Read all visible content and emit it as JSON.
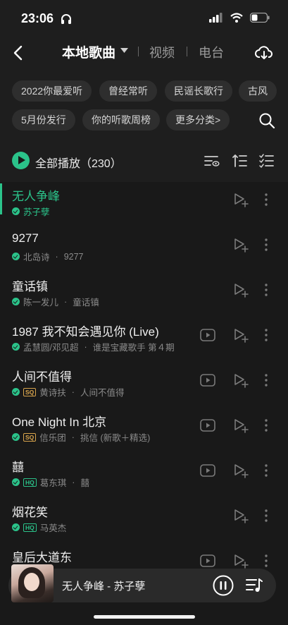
{
  "status_bar": {
    "time": "23:06"
  },
  "nav": {
    "title": "本地歌曲",
    "tabs": [
      "视频",
      "电台"
    ]
  },
  "chips": {
    "row1": [
      "2022你最爱听",
      "曾经常听",
      "民谣长歌行",
      "古风"
    ],
    "row2": [
      "5月份发行",
      "你的听歌周榜",
      "更多分类>"
    ]
  },
  "play_all": {
    "label": "全部播放（230）"
  },
  "songs": [
    {
      "title": "无人争峰",
      "artist": "苏子孽",
      "album": "",
      "quality": "",
      "has_video": false,
      "active": true
    },
    {
      "title": "9277",
      "artist": "北岛诗",
      "album": "9277",
      "quality": "",
      "has_video": false,
      "active": false
    },
    {
      "title": "童话镇",
      "artist": "陈一发儿",
      "album": "童话镇",
      "quality": "",
      "has_video": false,
      "active": false
    },
    {
      "title": "1987 我不知会遇见你 (Live)",
      "artist": "孟慧圆/邓见超",
      "album": "谁是宝藏歌手 第４期",
      "quality": "",
      "has_video": true,
      "active": false
    },
    {
      "title": "人间不值得",
      "artist": "黄诗扶",
      "album": "人间不值得",
      "quality": "SQ",
      "has_video": true,
      "active": false
    },
    {
      "title": "One Night In 北京",
      "artist": "信乐团",
      "album": "挑信 (新歌＋精选)",
      "quality": "SQ",
      "has_video": true,
      "active": false
    },
    {
      "title": "囍",
      "artist": "葛东琪",
      "album": "囍",
      "quality": "HQ",
      "has_video": true,
      "active": false
    },
    {
      "title": "烟花笑",
      "artist": "马英杰",
      "album": "",
      "quality": "HQ",
      "has_video": false,
      "active": false
    },
    {
      "title": "皇后大道东",
      "artist": "",
      "album": "",
      "quality": "",
      "has_video": true,
      "active": false
    }
  ],
  "now_playing": {
    "title": "无人争峰 - 苏子孽"
  },
  "colors": {
    "accent": "#2bc38a",
    "background": "#191919",
    "sq_badge": "#d8a44c"
  }
}
